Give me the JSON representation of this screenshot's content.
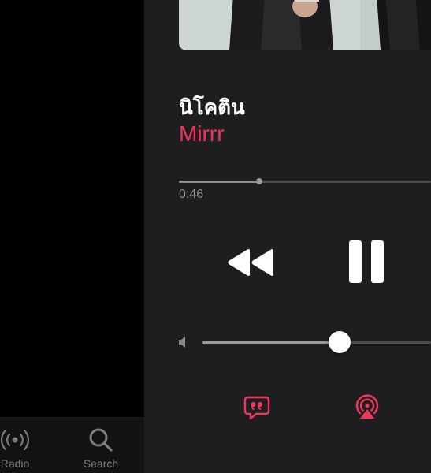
{
  "tabbar": {
    "items": [
      {
        "label": "Radio",
        "icon": "radio-icon"
      },
      {
        "label": "Search",
        "icon": "search-icon"
      }
    ]
  },
  "now_playing": {
    "title": "นิโคติน",
    "artist": "Mirrr",
    "elapsed": "0:46",
    "progress_fraction": 0.32,
    "volume_fraction": 0.6
  },
  "colors": {
    "accent": "#f2365a",
    "sheet_background": "#1e1e20",
    "text_primary": "#ffffff",
    "text_secondary": "#8a8a8e"
  },
  "icons": {
    "rewind": "rewind-icon",
    "pause": "pause-icon",
    "volume_low": "volume-low-icon",
    "lyrics": "lyrics-icon",
    "airplay": "airplay-icon"
  }
}
